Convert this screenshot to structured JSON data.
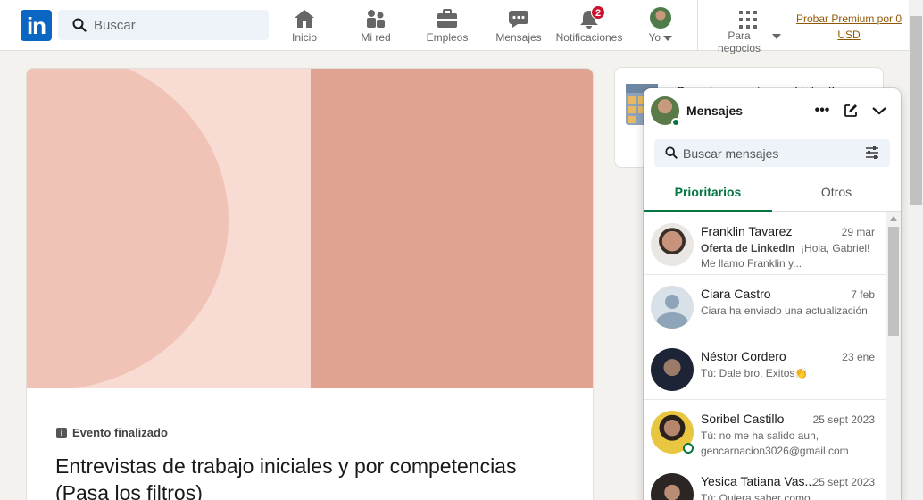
{
  "nav": {
    "search_placeholder": "Buscar",
    "items": [
      {
        "label": "Inicio",
        "icon": "home-icon"
      },
      {
        "label": "Mi red",
        "icon": "network-icon"
      },
      {
        "label": "Empleos",
        "icon": "jobs-icon"
      },
      {
        "label": "Mensajes",
        "icon": "messaging-icon"
      },
      {
        "label": "Notificaciones",
        "icon": "bell-icon",
        "badge": "2"
      },
      {
        "label": "Yo",
        "icon": "avatar"
      }
    ],
    "business_label_1": "Para",
    "business_label_2": "negocios",
    "premium": "Probar Premium por 0 USD"
  },
  "event": {
    "status": "Evento finalizado",
    "title": "Entrevistas de trabajo iniciales y por competencias (Pasa los filtros)"
  },
  "side_card": {
    "text": "Organiza eventos en LinkedIn"
  },
  "messaging": {
    "title": "Mensajes",
    "search_placeholder": "Buscar mensajes",
    "tabs": [
      "Prioritarios",
      "Otros"
    ],
    "conversations": [
      {
        "name": "Franklin Tavarez",
        "date": "29 mar",
        "tag": "Oferta de LinkedIn",
        "preview": "¡Hola, Gabriel! Me llamo Franklin y..."
      },
      {
        "name": "Ciara Castro",
        "date": "7 feb",
        "tag": "",
        "preview": "Ciara ha enviado una actualización"
      },
      {
        "name": "Néstor Cordero",
        "date": "23 ene",
        "tag": "",
        "preview": "Tú: Dale bro, Exitos👏"
      },
      {
        "name": "Soribel Castillo",
        "date": "25 sept 2023",
        "tag": "",
        "preview": "Tú: no me ha salido aun, gencarnacion3026@gmail.com"
      },
      {
        "name": "Yesica Tatiana Vas...",
        "date": "25 sept 2023",
        "tag": "",
        "preview": "Tú: Quiera saber como"
      }
    ]
  },
  "colors": {
    "brand": "#0a66c2",
    "accent": "#057642",
    "badge": "#cb112d",
    "premium": "#915907"
  }
}
